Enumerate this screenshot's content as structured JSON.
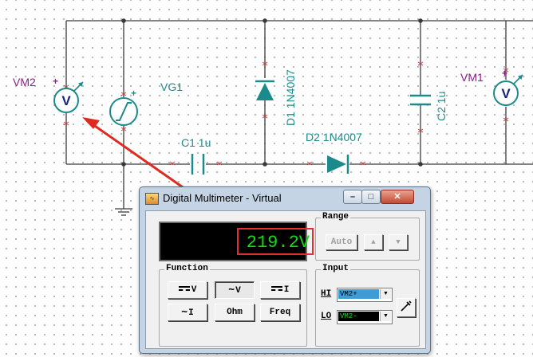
{
  "schematic": {
    "vm2": {
      "label": "VM2",
      "symbol": "V",
      "plus": "+"
    },
    "vg1": {
      "label": "VG1",
      "plus": "+"
    },
    "vm1": {
      "label": "VM1",
      "symbol": "V",
      "plus": "+"
    },
    "c1": {
      "label": "C1 1u"
    },
    "c2": {
      "label": "C2 1u"
    },
    "d1": {
      "label": "D1 1N4007"
    },
    "d2": {
      "label": "D2 1N4007"
    }
  },
  "multimeter": {
    "title": "Digital Multimeter - Virtual",
    "reading": "219.2V",
    "range": {
      "title": "Range",
      "auto_label": "Auto",
      "up_label": "▲",
      "down_label": "▼"
    },
    "function": {
      "title": "Function",
      "buttons": {
        "vdc": "V",
        "vac": "V",
        "idc": "I",
        "iac": "I",
        "ohm": "Ohm",
        "freq": "Freq"
      },
      "selected": "vac"
    },
    "input": {
      "title": "Input",
      "hi_label": "HI",
      "hi_value": "VM2+",
      "lo_label": "LO",
      "lo_value": "VM2-"
    }
  },
  "colors": {
    "wire": "#3a3a3a",
    "component": "#1b8a8a",
    "instrument_label": "#8a1e8a",
    "arrow": "#e02a20",
    "reading": "#18d818",
    "highlight": "#e03030"
  },
  "icons": [
    "voltmeter-icon",
    "signal-generator-icon",
    "diode-icon",
    "capacitor-icon",
    "ground-icon",
    "probe-icon"
  ]
}
